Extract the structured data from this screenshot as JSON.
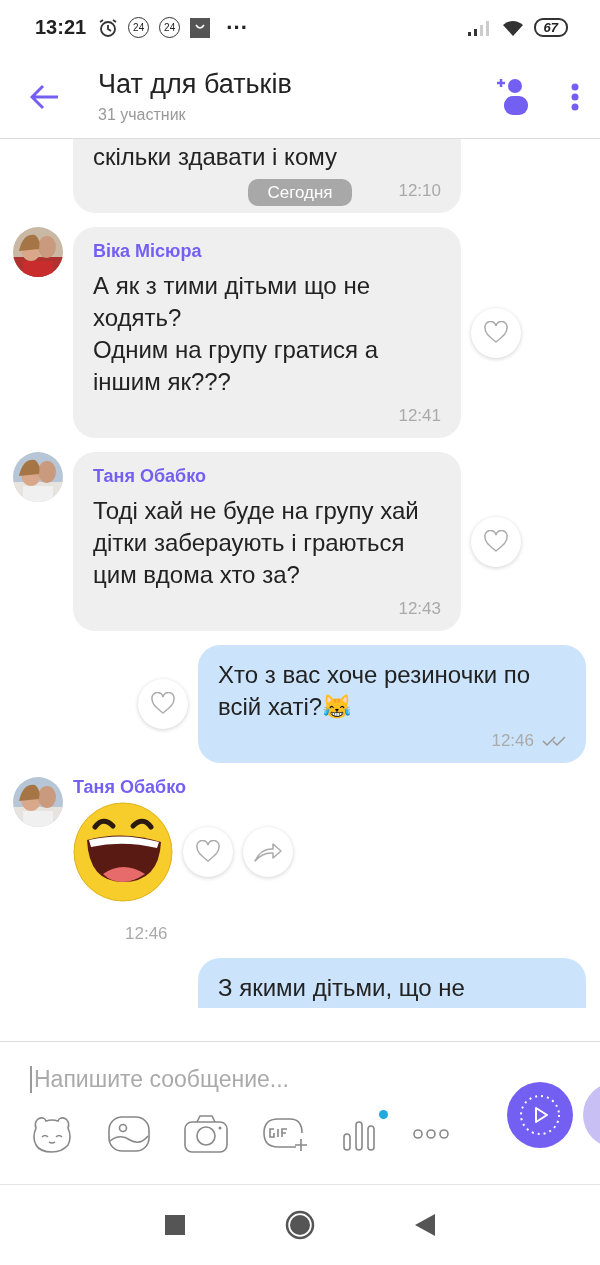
{
  "status_bar": {
    "time": "13:21",
    "badges": [
      "24",
      "24"
    ],
    "more": "···",
    "battery": "67"
  },
  "header": {
    "title": "Чат для батьків",
    "subtitle": "31 участник"
  },
  "date_chip": "Сегодня",
  "messages": [
    {
      "kind": "incoming",
      "cut": true,
      "text": "скільки здавати і кому",
      "time": "12:10"
    },
    {
      "kind": "incoming",
      "sender": "Віка Місюра",
      "text": "А як з тими дітьми що не ходять?\nОдним на групу гратися а іншим як???",
      "time": "12:41"
    },
    {
      "kind": "incoming",
      "sender": "Таня Обабко",
      "text": "Тоді хай не буде на групу хай дітки забераують і граються цим вдома хто за?",
      "time": "12:43"
    },
    {
      "kind": "outgoing",
      "text": "Хто з вас хоче резиночки по всій хаті?😹",
      "time": "12:46",
      "read": true
    },
    {
      "kind": "sticker",
      "sender": "Таня Обабко",
      "time": "12:46"
    },
    {
      "kind": "outgoing",
      "cut": true,
      "text": "З якими дітьми, що не"
    }
  ],
  "composer": {
    "placeholder": "Напишите сообщение...",
    "new_indicator": true
  }
}
